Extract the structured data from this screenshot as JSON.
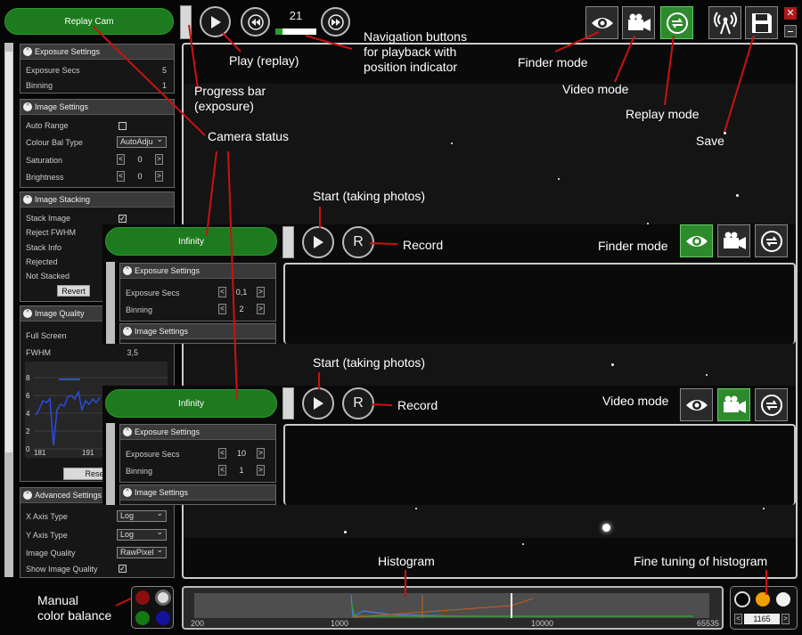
{
  "main": {
    "camera_status": "Replay Cam",
    "position_indicator": "21",
    "exposure": {
      "header": "Exposure Settings",
      "rows": [
        {
          "label": "Exposure Secs",
          "value": "5"
        },
        {
          "label": "Binning",
          "value": "1"
        }
      ]
    },
    "image": {
      "header": "Image Settings",
      "auto_range": "Auto Range",
      "colour_bal": "Colour Bal Type",
      "colour_bal_value": "AutoAdju",
      "saturation": "Saturation",
      "saturation_value": "0",
      "brightness": "Brightness",
      "brightness_value": "0"
    },
    "stacking": {
      "header": "Image Stacking",
      "stack_image": "Stack Image",
      "reject_fwhm": "Reject FWHM",
      "stack_info": "Stack Info",
      "rejected": "Rejected",
      "not_stacked": "Not Stacked",
      "revert": "Revert"
    },
    "quality": {
      "header": "Image Quality",
      "full_screen": "Full Screen",
      "fwhm": "FWHM",
      "fwhm_value": "3,5",
      "yticks": [
        "8",
        "6",
        "4",
        "2",
        "0"
      ],
      "xticks": [
        "181",
        "191"
      ],
      "reset": "Rese"
    },
    "advanced": {
      "header": "Advanced Settings",
      "x_axis": "X Axis Type",
      "x_axis_value": "Log",
      "y_axis": "Y Axis Type",
      "y_axis_value": "Log",
      "image_quality": "Image Quality",
      "image_quality_value": "RawPixel",
      "show_quality": "Show Image Quality"
    },
    "histogram": {
      "ticks": [
        "200",
        "1000",
        "10000",
        "65535"
      ]
    },
    "fine_tune_value": "1165"
  },
  "finder": {
    "camera_status": "Infinity",
    "record": "R",
    "exposure_header": "Exposure Settings",
    "exposure_secs": "Exposure Secs",
    "exposure_value": "0,1",
    "binning": "Binning",
    "binning_value": "2",
    "image_header": "Image Settings"
  },
  "video": {
    "camera_status": "Infinity",
    "record": "R",
    "exposure_header": "Exposure Settings",
    "exposure_secs": "Exposure Secs",
    "exposure_value": "10",
    "binning": "Binning",
    "binning_value": "1",
    "image_header": "Image Settings"
  },
  "annotations": {
    "play": "Play (replay)",
    "nav": [
      "Navigation buttons",
      "for playback with",
      "position indicator"
    ],
    "finder_mode": "Finder mode",
    "video_mode": "Video mode",
    "replay_mode": "Replay mode",
    "save": "Save",
    "progress": [
      "Progress bar",
      "(exposure)"
    ],
    "camera_status": "Camera status",
    "start1": "Start (taking photos)",
    "record1": "Record",
    "finder_mode2": "Finder mode",
    "start2": "Start (taking photos)",
    "record2": "Record",
    "video_mode2": "Video mode",
    "histogram": "Histogram",
    "fine_tuning": "Fine tuning of histogram",
    "manual_color": [
      "Manual",
      "color balance"
    ]
  },
  "colors": {
    "green": "#1e7a1e",
    "accent_red": "#cc1111",
    "highlight": "#2d8a2d"
  },
  "chart_data": {
    "type": "line",
    "yticks": [
      0,
      2,
      4,
      6,
      8
    ],
    "xticks": [
      181,
      191
    ],
    "ylim": [
      0,
      9
    ]
  }
}
